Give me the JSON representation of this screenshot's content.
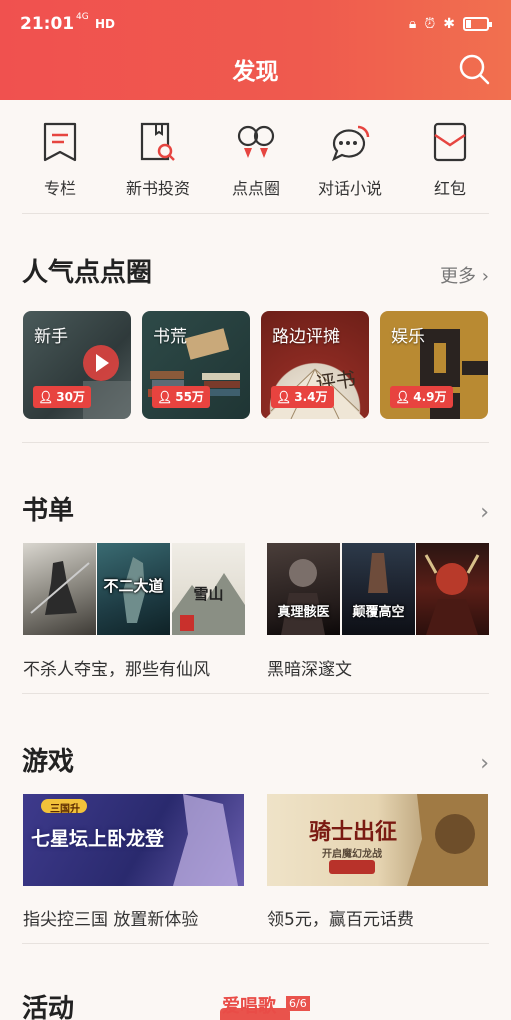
{
  "status": {
    "time": "21:01",
    "net": "4G",
    "hd": "HD"
  },
  "header": {
    "title": "发现"
  },
  "quick": [
    {
      "label": "专栏",
      "icon": "bookmark-icon"
    },
    {
      "label": "新书投资",
      "icon": "book-search-icon"
    },
    {
      "label": "点点圈",
      "icon": "circle-dots-icon"
    },
    {
      "label": "对话小说",
      "icon": "chat-icon"
    },
    {
      "label": "红包",
      "icon": "red-envelope-icon"
    }
  ],
  "popular": {
    "title": "人气点点圈",
    "more": "更多",
    "cards": [
      {
        "label": "新手",
        "count": "30万"
      },
      {
        "label": "书荒",
        "count": "55万"
      },
      {
        "label": "路边评摊",
        "count": "3.4万"
      },
      {
        "label": "娱乐",
        "count": "4.9万"
      }
    ]
  },
  "booklists": {
    "title": "书单",
    "lists": [
      {
        "caption": "不杀人夺宝，那些有仙风",
        "covers": [
          "",
          "不二大道",
          "雪山"
        ]
      },
      {
        "caption": "黑暗深邃文",
        "covers": [
          "真理骸医",
          "颠覆高空",
          ""
        ]
      }
    ]
  },
  "games": {
    "title": "游戏",
    "items": [
      {
        "caption": "指尖控三国 放置新体验",
        "banner_title": "七星坛上卧龙登",
        "banner_sub": "三国升"
      },
      {
        "caption": "领5元，赢百元话费",
        "banner_title": "骑士出征",
        "banner_sub": "开启魔幻龙战"
      }
    ]
  },
  "activity": {
    "title": "活动"
  },
  "watermark": "爱唱歌",
  "page_indicator": "6/6",
  "colors": {
    "accent": "#ef5350",
    "badge": "#e8433f"
  }
}
